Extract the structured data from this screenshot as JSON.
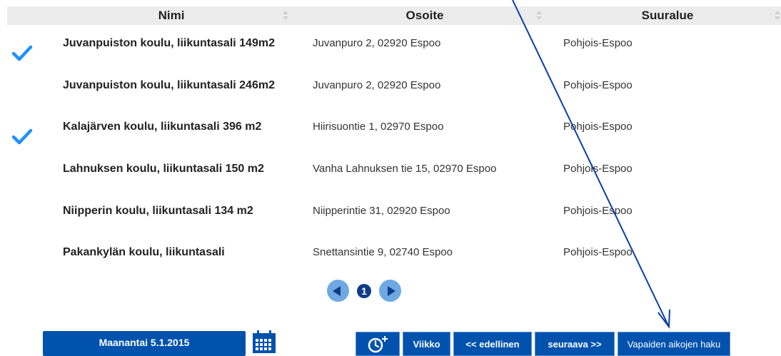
{
  "table": {
    "headers": {
      "nimi": "Nimi",
      "osoite": "Osoite",
      "suuralue": "Suuralue"
    },
    "rows": [
      {
        "checked": true,
        "name": "Juvanpuiston koulu, liikuntasali 149m2",
        "address": "Juvanpuro 2, 02920 Espoo",
        "area": "Pohjois-Espoo"
      },
      {
        "checked": false,
        "name": "Juvanpuiston koulu, liikuntasali 246m2",
        "address": "Juvanpuro 2, 02920 Espoo",
        "area": "Pohjois-Espoo"
      },
      {
        "checked": true,
        "name": "Kalajärven koulu, liikuntasali 396 m2",
        "address": "Hiirisuontie 1, 02970 Espoo",
        "area": "Pohjois-Espoo"
      },
      {
        "checked": false,
        "name": "Lahnuksen koulu, liikuntasali 150 m2",
        "address": "Vanha Lahnuksen tie 15, 02970 Espoo",
        "area": "Pohjois-Espoo"
      },
      {
        "checked": false,
        "name": "Niipperin koulu, liikuntasali 134 m2",
        "address": "Niipperintie 31, 02920 Espoo",
        "area": "Pohjois-Espoo"
      },
      {
        "checked": false,
        "name": "Pakankylän koulu, liikuntasali",
        "address": "Snettansintie 9, 02740 Espoo",
        "area": "Pohjois-Espoo"
      }
    ]
  },
  "pager": {
    "current_page": "1"
  },
  "bottom": {
    "date_label": "Maanantai 5.1.2015",
    "week_label": "Viikko",
    "prev_label": "<< edellinen",
    "next_label": "seuraava >>",
    "search_label": "Vapaiden aikojen haku"
  },
  "colors": {
    "accent": "#0052ad",
    "check": "#1e90ff",
    "annotation_arrow": "#0a3ea8"
  },
  "icons": {
    "calendar": "calendar-icon",
    "clock_plus": "clock-plus-icon",
    "check": "checkmark-icon"
  }
}
